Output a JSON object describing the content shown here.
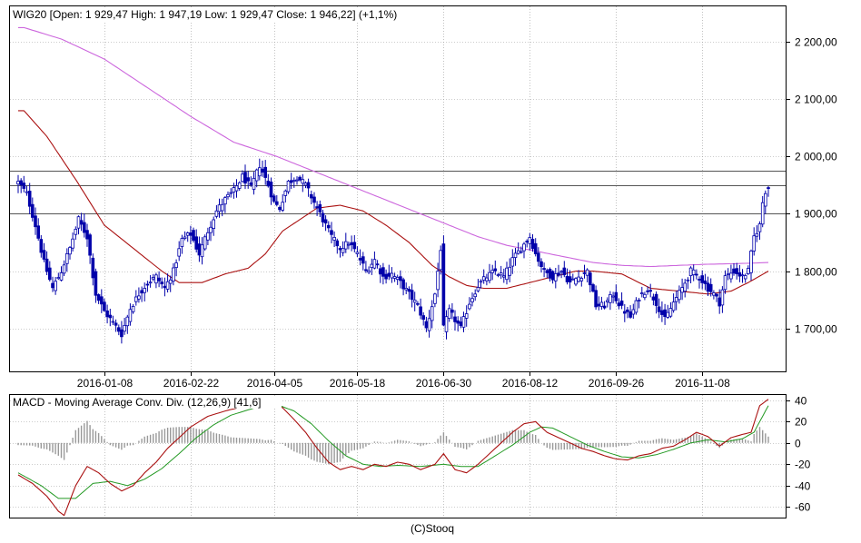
{
  "colors": {
    "candle": "#0000aa",
    "ma_short": "#aa1111",
    "ma_long": "#cc66dd",
    "macd_line": "#aa1111",
    "signal_line": "#229922",
    "histogram": "#999999",
    "grid": "#999999",
    "frame": "#000000",
    "hline": "#555555"
  },
  "chart_data": [
    {
      "type": "candlestick",
      "title": "WIG20 [Open: 1 929,47  High: 1 947,19  Low: 1 929,47  Close: 1 946,22] (+1,1%)",
      "yticks": [
        {
          "v": 1700,
          "label": "1 700,00"
        },
        {
          "v": 1800,
          "label": "1 800,00"
        },
        {
          "v": 1900,
          "label": "1 900,00"
        },
        {
          "v": 2000,
          "label": "2 000,00"
        },
        {
          "v": 2100,
          "label": "2 100,00"
        },
        {
          "v": 2200,
          "label": "2 200,00"
        }
      ],
      "ylim": [
        1625,
        2262
      ],
      "xlim": [
        0,
        261
      ],
      "xticks": [
        {
          "i": 30,
          "label": "2016-01-08"
        },
        {
          "i": 60,
          "label": "2016-02-22"
        },
        {
          "i": 89,
          "label": "2016-04-05"
        },
        {
          "i": 118,
          "label": "2016-05-18"
        },
        {
          "i": 148,
          "label": "2016-06-30"
        },
        {
          "i": 178,
          "label": "2016-08-12"
        },
        {
          "i": 208,
          "label": "2016-09-26"
        },
        {
          "i": 238,
          "label": "2016-11-08"
        }
      ],
      "hlines": [
        1975,
        1950,
        1900
      ],
      "close_anchors": [
        [
          0,
          1955
        ],
        [
          3,
          1935
        ],
        [
          6,
          1880
        ],
        [
          9,
          1815
        ],
        [
          12,
          1770
        ],
        [
          15,
          1800
        ],
        [
          18,
          1840
        ],
        [
          21,
          1890
        ],
        [
          24,
          1860
        ],
        [
          27,
          1760
        ],
        [
          30,
          1730
        ],
        [
          33,
          1710
        ],
        [
          36,
          1690
        ],
        [
          39,
          1735
        ],
        [
          42,
          1760
        ],
        [
          45,
          1780
        ],
        [
          48,
          1790
        ],
        [
          51,
          1770
        ],
        [
          54,
          1800
        ],
        [
          57,
          1855
        ],
        [
          60,
          1865
        ],
        [
          63,
          1830
        ],
        [
          66,
          1870
        ],
        [
          69,
          1905
        ],
        [
          72,
          1925
        ],
        [
          75,
          1940
        ],
        [
          78,
          1965
        ],
        [
          81,
          1945
        ],
        [
          84,
          1985
        ],
        [
          87,
          1950
        ],
        [
          89,
          1920
        ],
        [
          91,
          1910
        ],
        [
          94,
          1955
        ],
        [
          97,
          1965
        ],
        [
          100,
          1950
        ],
        [
          103,
          1920
        ],
        [
          106,
          1890
        ],
        [
          109,
          1860
        ],
        [
          112,
          1840
        ],
        [
          115,
          1850
        ],
        [
          118,
          1830
        ],
        [
          121,
          1800
        ],
        [
          124,
          1820
        ],
        [
          127,
          1790
        ],
        [
          130,
          1795
        ],
        [
          133,
          1780
        ],
        [
          136,
          1760
        ],
        [
          139,
          1740
        ],
        [
          142,
          1700
        ],
        [
          145,
          1760
        ],
        [
          147,
          1840
        ],
        [
          148,
          1700
        ],
        [
          150,
          1730
        ],
        [
          152,
          1715
        ],
        [
          154,
          1700
        ],
        [
          157,
          1745
        ],
        [
          160,
          1775
        ],
        [
          163,
          1790
        ],
        [
          166,
          1800
        ],
        [
          169,
          1790
        ],
        [
          172,
          1820
        ],
        [
          175,
          1840
        ],
        [
          178,
          1860
        ],
        [
          180,
          1830
        ],
        [
          183,
          1800
        ],
        [
          186,
          1790
        ],
        [
          189,
          1800
        ],
        [
          192,
          1780
        ],
        [
          195,
          1790
        ],
        [
          198,
          1800
        ],
        [
          201,
          1740
        ],
        [
          204,
          1740
        ],
        [
          207,
          1760
        ],
        [
          210,
          1735
        ],
        [
          213,
          1720
        ],
        [
          216,
          1755
        ],
        [
          219,
          1770
        ],
        [
          222,
          1745
        ],
        [
          225,
          1715
        ],
        [
          228,
          1745
        ],
        [
          231,
          1770
        ],
        [
          234,
          1800
        ],
        [
          237,
          1790
        ],
        [
          240,
          1770
        ],
        [
          242,
          1760
        ],
        [
          244,
          1745
        ],
        [
          246,
          1790
        ],
        [
          249,
          1800
        ],
        [
          252,
          1790
        ],
        [
          254,
          1800
        ],
        [
          256,
          1860
        ],
        [
          258,
          1880
        ],
        [
          259,
          1920
        ],
        [
          260,
          1940
        ],
        [
          261,
          1946
        ]
      ],
      "ma_short_anchors": [
        [
          2,
          2080
        ],
        [
          10,
          2035
        ],
        [
          20,
          1960
        ],
        [
          30,
          1880
        ],
        [
          40,
          1840
        ],
        [
          50,
          1800
        ],
        [
          56,
          1780
        ],
        [
          64,
          1780
        ],
        [
          72,
          1795
        ],
        [
          80,
          1805
        ],
        [
          86,
          1830
        ],
        [
          92,
          1870
        ],
        [
          98,
          1890
        ],
        [
          104,
          1910
        ],
        [
          112,
          1915
        ],
        [
          120,
          1905
        ],
        [
          128,
          1880
        ],
        [
          136,
          1850
        ],
        [
          144,
          1810
        ],
        [
          150,
          1790
        ],
        [
          156,
          1775
        ],
        [
          162,
          1770
        ],
        [
          170,
          1770
        ],
        [
          178,
          1780
        ],
        [
          186,
          1790
        ],
        [
          194,
          1800
        ],
        [
          200,
          1800
        ],
        [
          210,
          1795
        ],
        [
          220,
          1770
        ],
        [
          230,
          1765
        ],
        [
          240,
          1760
        ],
        [
          248,
          1765
        ],
        [
          254,
          1780
        ],
        [
          261,
          1800
        ]
      ],
      "ma_long_anchors": [
        [
          2,
          2225
        ],
        [
          15,
          2205
        ],
        [
          30,
          2170
        ],
        [
          45,
          2120
        ],
        [
          60,
          2070
        ],
        [
          75,
          2025
        ],
        [
          90,
          2000
        ],
        [
          100,
          1980
        ],
        [
          110,
          1960
        ],
        [
          120,
          1940
        ],
        [
          130,
          1920
        ],
        [
          140,
          1900
        ],
        [
          150,
          1880
        ],
        [
          160,
          1860
        ],
        [
          170,
          1845
        ],
        [
          180,
          1835
        ],
        [
          190,
          1825
        ],
        [
          200,
          1815
        ],
        [
          210,
          1810
        ],
        [
          220,
          1808
        ],
        [
          230,
          1810
        ],
        [
          240,
          1812
        ],
        [
          250,
          1813
        ],
        [
          261,
          1815
        ]
      ]
    },
    {
      "type": "macd",
      "title": "MACD - Moving Average Conv. Div. (12,26,9) [41,6]",
      "yticks": [
        {
          "v": 40,
          "label": "40"
        },
        {
          "v": 20,
          "label": "20"
        },
        {
          "v": 0,
          "label": "0"
        },
        {
          "v": -20,
          "label": "-20"
        },
        {
          "v": -40,
          "label": "-40"
        },
        {
          "v": -60,
          "label": "-60"
        }
      ],
      "ylim": [
        -70,
        45
      ],
      "macd_anchors": [
        [
          0,
          -30
        ],
        [
          5,
          -38
        ],
        [
          10,
          -50
        ],
        [
          14,
          -64
        ],
        [
          16,
          -68
        ],
        [
          20,
          -40
        ],
        [
          24,
          -22
        ],
        [
          28,
          -28
        ],
        [
          32,
          -38
        ],
        [
          36,
          -45
        ],
        [
          40,
          -40
        ],
        [
          44,
          -28
        ],
        [
          48,
          -18
        ],
        [
          52,
          -5
        ],
        [
          56,
          5
        ],
        [
          60,
          15
        ],
        [
          66,
          25
        ],
        [
          72,
          30
        ],
        [
          78,
          34
        ],
        [
          84,
          38
        ],
        [
          88,
          39
        ],
        [
          92,
          33
        ],
        [
          96,
          22
        ],
        [
          100,
          10
        ],
        [
          104,
          -5
        ],
        [
          108,
          -18
        ],
        [
          112,
          -25
        ],
        [
          116,
          -22
        ],
        [
          120,
          -25
        ],
        [
          124,
          -20
        ],
        [
          128,
          -22
        ],
        [
          132,
          -18
        ],
        [
          136,
          -20
        ],
        [
          140,
          -25
        ],
        [
          145,
          -20
        ],
        [
          148,
          -10
        ],
        [
          152,
          -25
        ],
        [
          156,
          -28
        ],
        [
          160,
          -20
        ],
        [
          164,
          -10
        ],
        [
          168,
          0
        ],
        [
          172,
          10
        ],
        [
          176,
          18
        ],
        [
          180,
          20
        ],
        [
          184,
          10
        ],
        [
          188,
          5
        ],
        [
          192,
          0
        ],
        [
          196,
          -5
        ],
        [
          200,
          -8
        ],
        [
          204,
          -12
        ],
        [
          208,
          -15
        ],
        [
          212,
          -16
        ],
        [
          216,
          -12
        ],
        [
          220,
          -10
        ],
        [
          224,
          -5
        ],
        [
          228,
          -3
        ],
        [
          232,
          3
        ],
        [
          236,
          10
        ],
        [
          240,
          6
        ],
        [
          244,
          -3
        ],
        [
          248,
          5
        ],
        [
          252,
          8
        ],
        [
          255,
          10
        ],
        [
          258,
          35
        ],
        [
          261,
          41
        ]
      ],
      "signal_anchors": [
        [
          0,
          -28
        ],
        [
          8,
          -40
        ],
        [
          14,
          -52
        ],
        [
          20,
          -52
        ],
        [
          26,
          -38
        ],
        [
          32,
          -36
        ],
        [
          38,
          -40
        ],
        [
          44,
          -34
        ],
        [
          50,
          -24
        ],
        [
          56,
          -10
        ],
        [
          62,
          5
        ],
        [
          68,
          17
        ],
        [
          74,
          26
        ],
        [
          80,
          31
        ],
        [
          86,
          36
        ],
        [
          90,
          36
        ],
        [
          96,
          30
        ],
        [
          102,
          18
        ],
        [
          108,
          2
        ],
        [
          114,
          -12
        ],
        [
          120,
          -20
        ],
        [
          126,
          -22
        ],
        [
          132,
          -21
        ],
        [
          140,
          -22
        ],
        [
          148,
          -20
        ],
        [
          154,
          -22
        ],
        [
          160,
          -22
        ],
        [
          166,
          -12
        ],
        [
          172,
          -2
        ],
        [
          178,
          10
        ],
        [
          182,
          15
        ],
        [
          186,
          14
        ],
        [
          192,
          6
        ],
        [
          198,
          -2
        ],
        [
          204,
          -8
        ],
        [
          210,
          -13
        ],
        [
          216,
          -14
        ],
        [
          222,
          -11
        ],
        [
          228,
          -6
        ],
        [
          234,
          0
        ],
        [
          240,
          3
        ],
        [
          246,
          1
        ],
        [
          252,
          4
        ],
        [
          256,
          10
        ],
        [
          261,
          35
        ]
      ]
    }
  ],
  "footer": "(C)Stooq"
}
